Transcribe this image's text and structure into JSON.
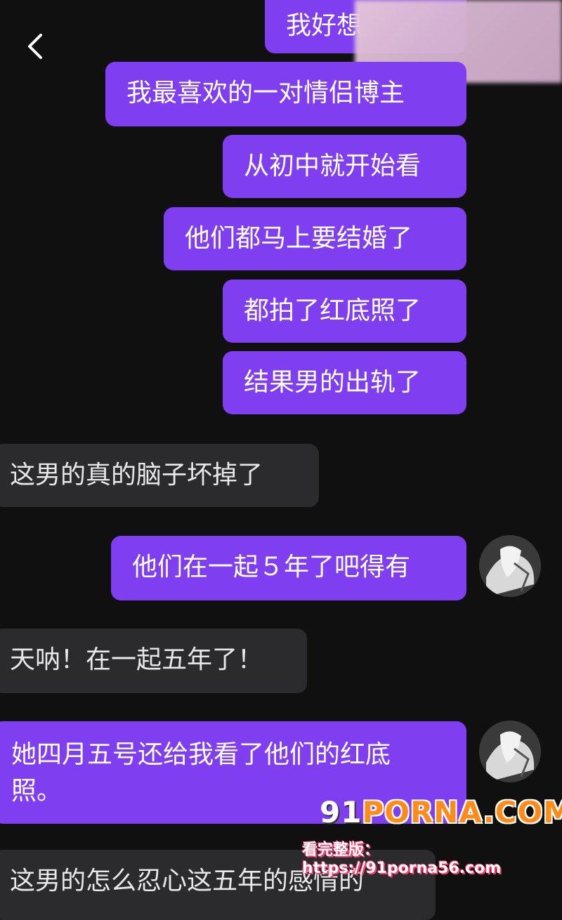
{
  "nav": {
    "back_icon": "chevron-left-icon"
  },
  "messages": [
    {
      "side": "out",
      "text": "我好想"
    },
    {
      "side": "out",
      "text": "我最喜欢的一对情侣博主"
    },
    {
      "side": "out",
      "text": "从初中就开始看"
    },
    {
      "side": "out",
      "text": "他们都马上要结婚了"
    },
    {
      "side": "out",
      "text": "都拍了红底照了"
    },
    {
      "side": "out",
      "text": "结果男的出轨了"
    },
    {
      "side": "in",
      "text": "这男的真的脑子坏掉了"
    },
    {
      "side": "out",
      "text": "他们在一起５年了吧得有"
    },
    {
      "side": "in",
      "text": "天呐！在一起五年了！"
    },
    {
      "side": "out",
      "text_line1": "她四月五号还给我看了他们的红底",
      "text_line2": "照。"
    },
    {
      "side": "in",
      "text": "这男的怎么忍心这五年的感情的"
    }
  ],
  "watermark": {
    "brand_prefix": "91",
    "brand_name": "PORNA.COM",
    "subtitle": "看完整版：https://91porna56.com"
  },
  "colors": {
    "outgoing": "#7f3ff0",
    "incoming": "#2b2a2d",
    "background": "#111011"
  }
}
